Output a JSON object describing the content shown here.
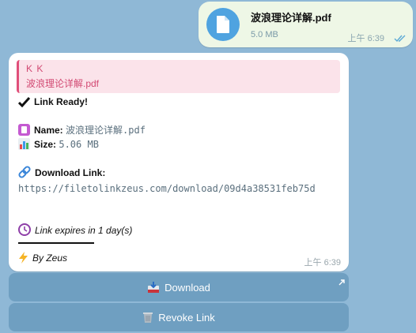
{
  "outgoing": {
    "file_name": "波浪理论详解.pdf",
    "file_size": "5.0 MB",
    "time": "上午 6:39",
    "icon": "document-icon",
    "ticks_icon": "double-check-icon"
  },
  "incoming": {
    "reply_to": {
      "name": "K K",
      "text": "波浪理论详解.pdf"
    },
    "status": "Link Ready!",
    "name_label": "Name:",
    "name_value": "波浪理论详解.pdf",
    "size_label": "Size:",
    "size_value": "5.06 MB",
    "download_label": "Download Link:",
    "download_url": "https://filetolinkzeus.com/download/09d4a38531feb75d",
    "expires_text": "Link expires in 1 day(s)",
    "signature": "By Zeus",
    "time": "上午 6:39"
  },
  "buttons": {
    "download_label": "Download",
    "revoke_label": "Revoke Link"
  },
  "colors": {
    "chat_background": "#8fb8d6",
    "outgoing_bubble": "#eef7e6",
    "reply_accent": "#e04f7a",
    "button_background": "#6f9fc1"
  }
}
